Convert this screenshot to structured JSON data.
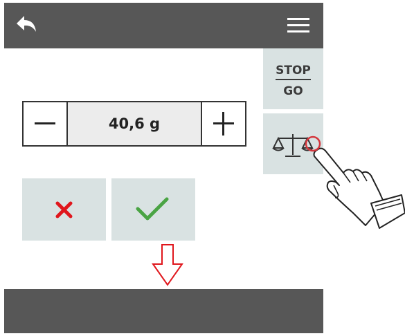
{
  "topbar": {
    "back_icon": "back-arrow-icon",
    "menu_icon": "hamburger-menu-icon"
  },
  "side": {
    "stop_label": "STOP",
    "go_label": "GO",
    "scale_icon": "scale-icon"
  },
  "stepper": {
    "value": "40,6 g",
    "minus_icon": "minus-icon",
    "plus_icon": "plus-icon"
  },
  "actions": {
    "cancel_icon": "x-icon",
    "confirm_icon": "checkmark-icon"
  },
  "colors": {
    "bar": "#575757",
    "button_bg": "#d9e2e2",
    "cancel": "#e0161c",
    "confirm": "#4aa444",
    "arrow": "#e0161c",
    "touch_indicator": "#d4363c"
  }
}
